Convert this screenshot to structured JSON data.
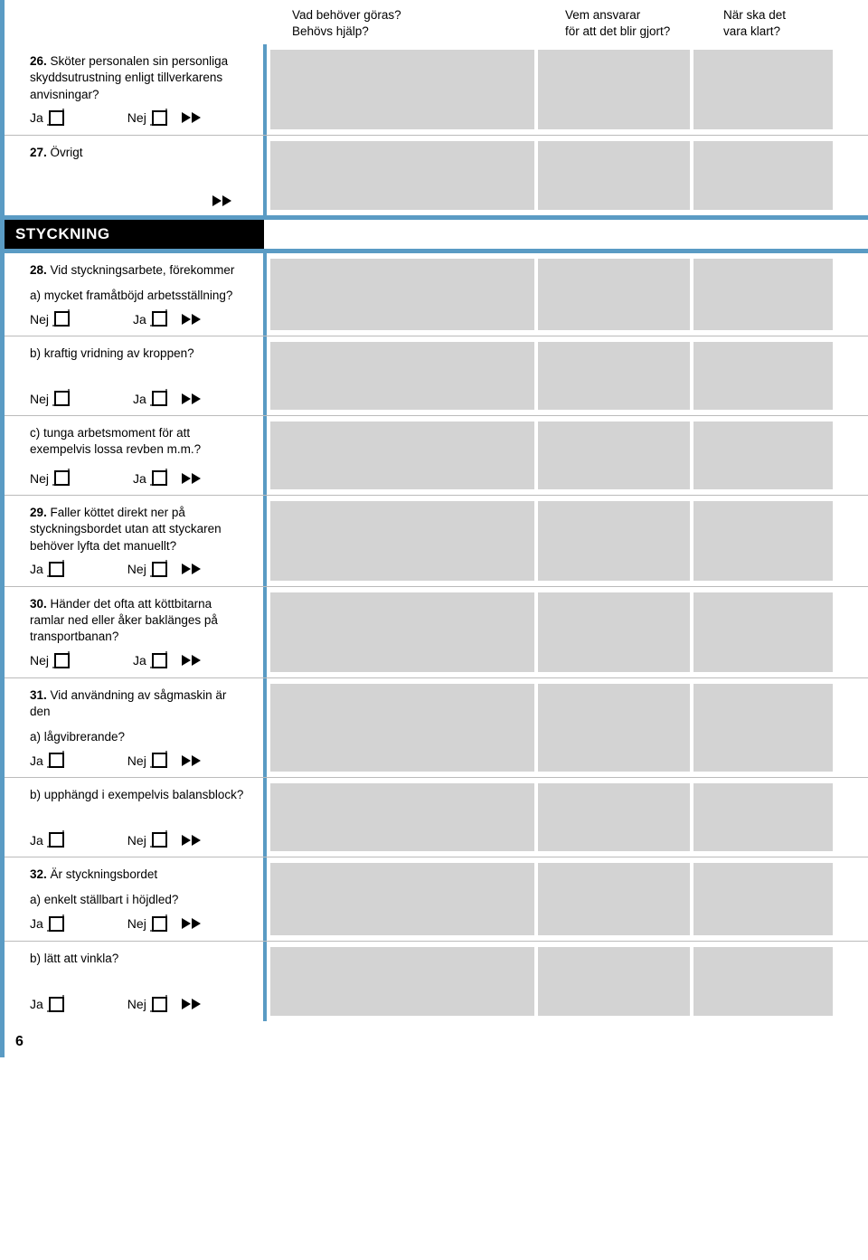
{
  "header": {
    "col1_line1": "Vad behöver göras?",
    "col1_line2": "Behövs hjälp?",
    "col2_line1": "Vem ansvarar",
    "col2_line2": "för att det blir gjort?",
    "col3_line1": "När ska det",
    "col3_line2": "vara klart?"
  },
  "labels": {
    "ja": "Ja",
    "nej": "Nej"
  },
  "section": {
    "title": "STYCKNING"
  },
  "q26": {
    "num": "26.",
    "text": " Sköter personalen sin personliga skyddsutrustning enligt tillverkarens anvisningar?"
  },
  "q27": {
    "num": "27.",
    "text": " Övrigt"
  },
  "q28": {
    "num": "28.",
    "intro": " Vid styckningsarbete, förekommer",
    "a": "a) mycket framåtböjd arbetsställning?",
    "b": "b) kraftig vridning av kroppen?",
    "c": "c) tunga arbetsmoment för att exempelvis lossa revben m.m.?"
  },
  "q29": {
    "num": "29.",
    "text": " Faller köttet direkt ner på styckningsbordet utan att styckaren behöver lyfta det manuellt?"
  },
  "q30": {
    "num": "30.",
    "text": " Händer det ofta att köttbitarna ramlar ned eller åker baklänges på transportbanan?"
  },
  "q31": {
    "num": "31.",
    "intro": " Vid användning av sågmaskin är den",
    "a": "a) lågvibrerande?",
    "b": "b) upphängd i exempelvis balansblock?"
  },
  "q32": {
    "num": "32.",
    "intro": " Är styckningsbordet",
    "a": "a) enkelt ställbart i höjdled?",
    "b": "b) lätt att vinkla?"
  },
  "pageNumber": "6"
}
